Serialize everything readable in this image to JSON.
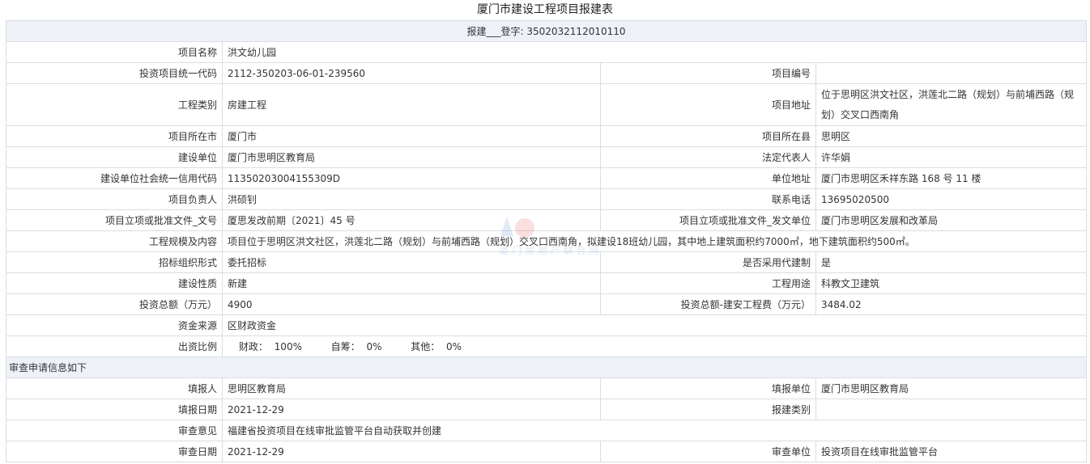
{
  "page_title": "厦门市建设工程项目报建表",
  "record_line": "报建___登字: 3502032112010110",
  "fields": {
    "project_name": {
      "label": "项目名称",
      "value": "洪文幼儿园"
    },
    "investment_code": {
      "label": "投资项目统一代码",
      "value": "2112-350203-06-01-239560"
    },
    "project_number": {
      "label": "项目编号",
      "value": ""
    },
    "project_type": {
      "label": "工程类别",
      "value": "房建工程"
    },
    "project_address": {
      "label": "项目地址",
      "value": "位于思明区洪文社区，洪莲北二路（规划）与前埔西路（规划）交叉口西南角"
    },
    "city": {
      "label": "项目所在市",
      "value": "厦门市"
    },
    "county": {
      "label": "项目所在县",
      "value": "思明区"
    },
    "construction_unit": {
      "label": "建设单位",
      "value": "厦门市思明区教育局"
    },
    "legal_rep": {
      "label": "法定代表人",
      "value": "许华娟"
    },
    "credit_code": {
      "label": "建设单位社会统一信用代码",
      "value": "11350203004155309D"
    },
    "unit_address": {
      "label": "单位地址",
      "value": "厦门市思明区禾祥东路 168 号 11 楼"
    },
    "project_leader": {
      "label": "项目负责人",
      "value": "洪硕钊"
    },
    "phone": {
      "label": "联系电话",
      "value": "13695020500"
    },
    "approval_doc_no": {
      "label": "项目立项或批准文件_文号",
      "value": "厦思发改前期〔2021〕45 号"
    },
    "approval_unit": {
      "label": "项目立项或批准文件_发文单位",
      "value": "厦门市思明区发展和改革局"
    },
    "scale": {
      "label": "工程规模及内容",
      "value": "项目位于思明区洪文社区，洪莲北二路（规划）与前埔西路（规划）交叉口西南角，拟建设18班幼儿园，其中地上建筑面积约7000㎡，地下建筑面积约500㎡。"
    },
    "tender_form": {
      "label": "招标组织形式",
      "value": "委托招标"
    },
    "agent_system": {
      "label": "是否采用代建制",
      "value": "是"
    },
    "construction_nature": {
      "label": "建设性质",
      "value": "新建"
    },
    "project_use": {
      "label": "工程用途",
      "value": "科教文卫建筑"
    },
    "total_investment": {
      "label": "投资总额（万元）",
      "value": "4900"
    },
    "install_cost": {
      "label": "投资总额-建安工程费（万元）",
      "value": "3484.02"
    },
    "fund_source": {
      "label": "资金来源",
      "value": "区财政资金"
    },
    "funding_ratio": {
      "label": "出资比例",
      "items": [
        {
          "name": "财政：",
          "value": "100%"
        },
        {
          "name": "自筹：",
          "value": "0%"
        },
        {
          "name": "其他：",
          "value": "0%"
        }
      ]
    }
  },
  "review_section_title": "审查申请信息如下",
  "review": {
    "filler": {
      "label": "填报人",
      "value": "思明区教育局"
    },
    "filler_unit": {
      "label": "填报单位",
      "value": "厦门市思明区教育局"
    },
    "fill_date": {
      "label": "填报日期",
      "value": "2021-12-29"
    },
    "record_type": {
      "label": "报建类别",
      "value": ""
    },
    "opinion": {
      "label": "审查意见",
      "value": "福建省投资项目在线审批监管平台自动获取并创建"
    },
    "review_date": {
      "label": "审查日期",
      "value": "2021-12-29"
    },
    "review_unit": {
      "label": "审查单位",
      "value": "投资项目在线审批监管平台"
    }
  },
  "watermark_text": "厦 门 房 地 产 联 合 网",
  "colors": {
    "band": "#eef2f8",
    "border": "#d9dde3",
    "text": "#333333"
  }
}
